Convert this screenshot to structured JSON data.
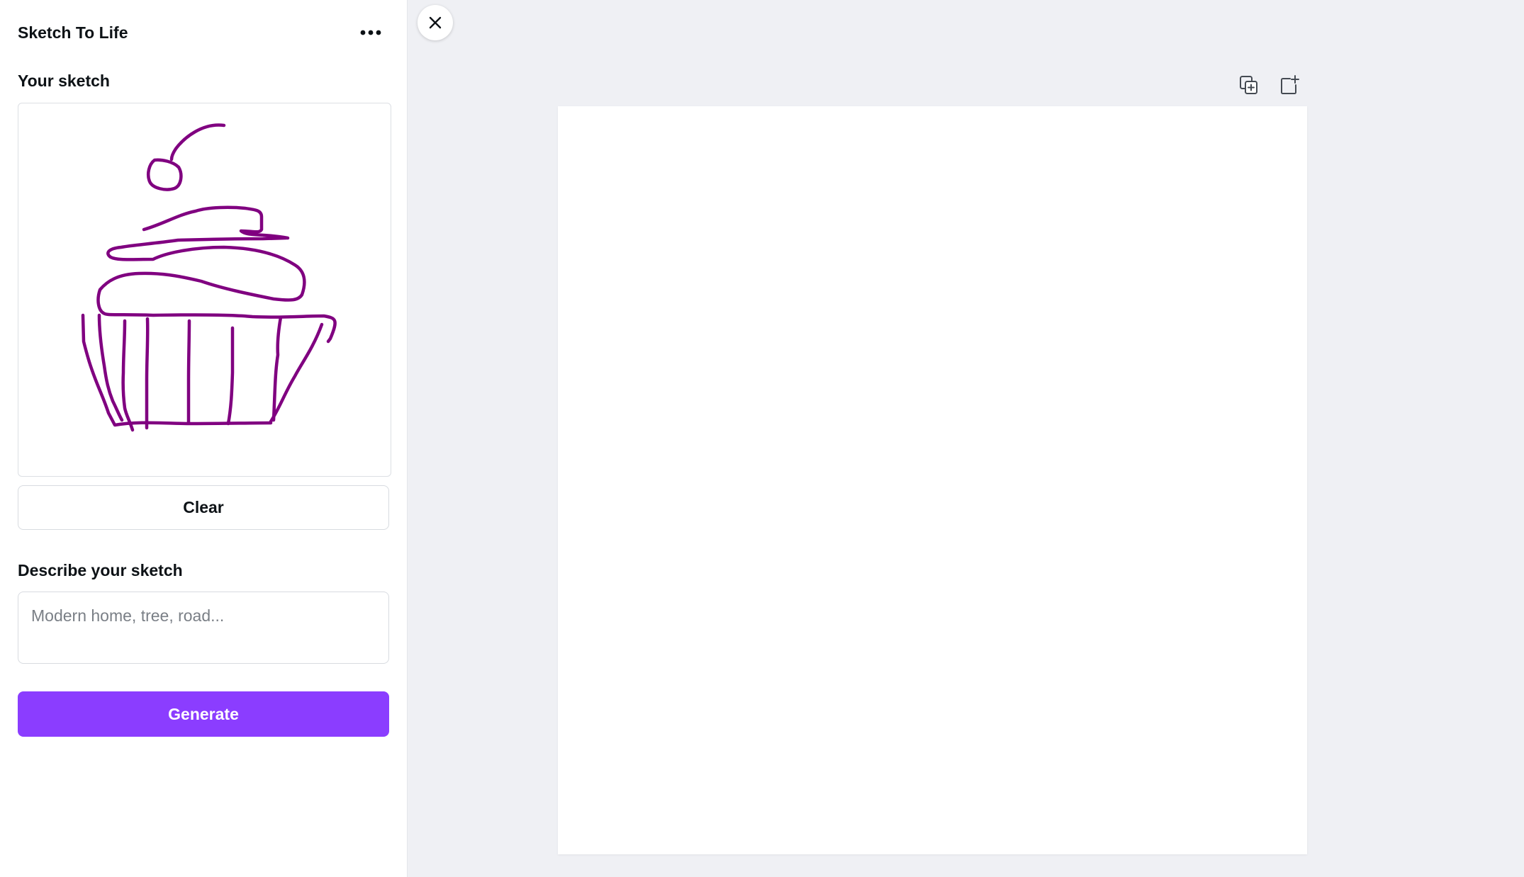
{
  "panel": {
    "title": "Sketch To Life",
    "more_icon": "more-horizontal-icon",
    "sketch_label": "Your sketch",
    "clear_label": "Clear",
    "describe_label": "Describe your sketch",
    "describe_placeholder": "Modern home, tree, road...",
    "describe_value": "",
    "generate_label": "Generate"
  },
  "sketch": {
    "stroke_color": "#800080",
    "subject_icon": "cupcake-drawing"
  },
  "canvas": {
    "close_icon": "close-icon",
    "tools": [
      {
        "icon": "duplicate-page-icon"
      },
      {
        "icon": "add-page-icon"
      }
    ]
  },
  "colors": {
    "accent": "#8b3dff",
    "workspace_bg": "#eff0f4",
    "panel_bg": "#ffffff"
  }
}
